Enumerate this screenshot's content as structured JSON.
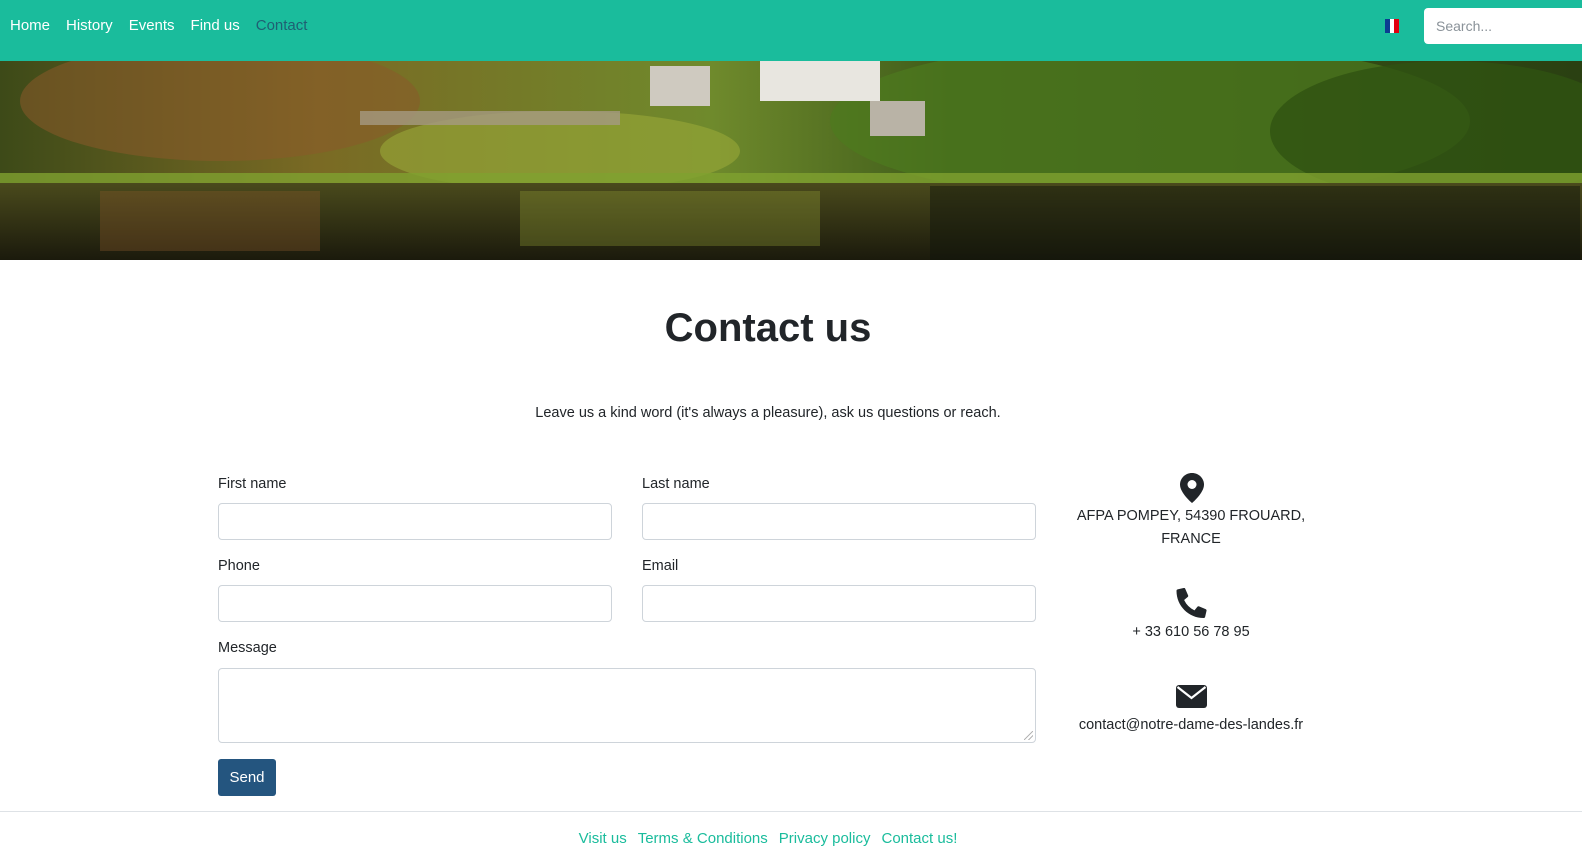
{
  "navbar": {
    "links": [
      {
        "label": "Home"
      },
      {
        "label": "History"
      },
      {
        "label": "Events"
      },
      {
        "label": "Find us"
      },
      {
        "label": "Contact"
      }
    ],
    "active_link": "Contact",
    "language_flag": "flag-france-icon",
    "search": {
      "placeholder": "Search...",
      "value": ""
    }
  },
  "colors": {
    "navbar": "#1abc9c",
    "active_link": "#1f5f73",
    "button": "#24557f",
    "footer_link": "#1abc9c"
  },
  "main": {
    "title": "Contact us",
    "subtitle": "Leave us a kind word (it's always a pleasure), ask us questions or reach."
  },
  "form": {
    "first_name": {
      "label": "First name",
      "value": ""
    },
    "last_name": {
      "label": "Last name",
      "value": ""
    },
    "phone": {
      "label": "Phone",
      "value": ""
    },
    "email": {
      "label": "Email",
      "value": ""
    },
    "message": {
      "label": "Message",
      "value": ""
    },
    "send_label": "Send"
  },
  "contact_info": {
    "address_line1": "AFPA POMPEY, 54390 FROUARD,",
    "address_line2": "FRANCE",
    "address_icon": "map-pin-icon",
    "phone": "+ 33 610 56 78 95",
    "phone_icon": "phone-icon",
    "email": "contact@notre-dame-des-landes.fr",
    "email_icon": "envelope-icon"
  },
  "footer": {
    "links": [
      {
        "label": "Visit us"
      },
      {
        "label": "Terms & Conditions"
      },
      {
        "label": "Privacy policy"
      },
      {
        "label": "Contact us!"
      }
    ]
  }
}
